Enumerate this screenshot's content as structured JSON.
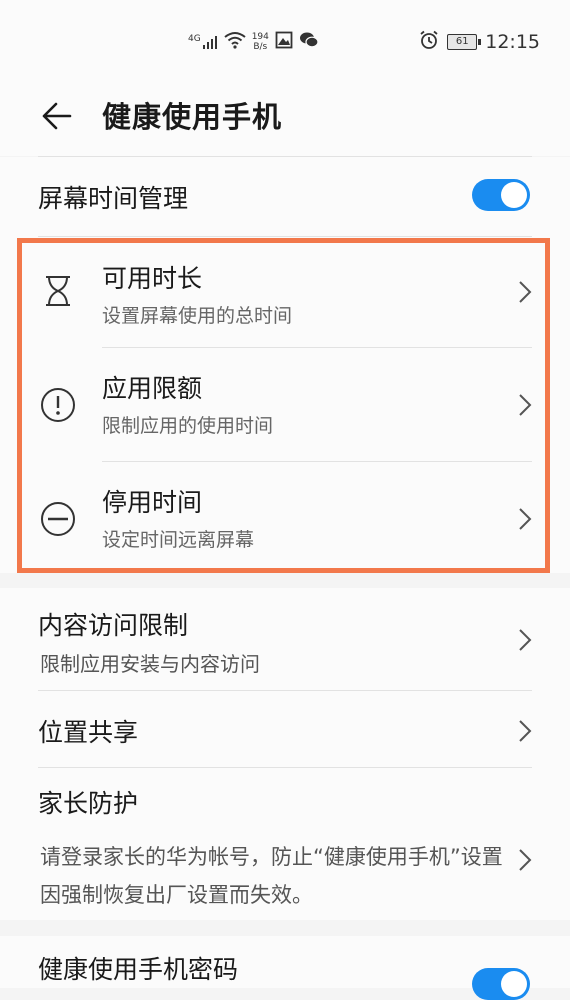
{
  "status_bar": {
    "network_type": "4G",
    "net_speed_value": "194",
    "net_speed_unit": "B/s",
    "battery": "61",
    "time": "12:15",
    "icons": [
      "signal-icon",
      "wifi-icon",
      "gallery-icon",
      "wechat-icon",
      "alarm-icon",
      "battery-icon"
    ]
  },
  "header": {
    "title": "健康使用手机"
  },
  "screen_time": {
    "label": "屏幕时间管理",
    "enabled": true
  },
  "items": [
    {
      "title": "可用时长",
      "subtitle": "设置屏幕使用的总时间",
      "icon": "hourglass-icon"
    },
    {
      "title": "应用限额",
      "subtitle": "限制应用的使用时间",
      "icon": "exclamation-circle-icon"
    },
    {
      "title": "停用时间",
      "subtitle": "设定时间远离屏幕",
      "icon": "minus-circle-icon"
    }
  ],
  "content_restriction": {
    "title": "内容访问限制",
    "subtitle": "限制应用安装与内容访问"
  },
  "location_share": {
    "title": "位置共享"
  },
  "parental": {
    "title": "家长防护",
    "description": "请登录家长的华为帐号，防止“健康使用手机”设置因强制恢复出厂设置而失效。"
  },
  "password": {
    "label": "健康使用手机密码",
    "enabled": true
  },
  "colors": {
    "accent": "#1a8cf0",
    "highlight": "#f2784b"
  }
}
